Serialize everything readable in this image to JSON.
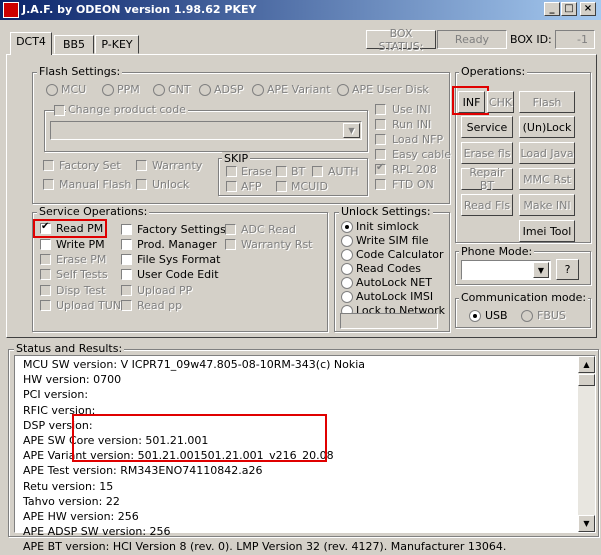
{
  "window": {
    "title": "J.A.F. by ODEON version 1.98.62 PKEY"
  },
  "tabs": [
    "DCT4",
    "BB5",
    "P-KEY"
  ],
  "header": {
    "box_status_label": "BOX STATUS:",
    "box_status_value": "Ready",
    "box_id_label": "BOX ID:",
    "box_id_value": "-1"
  },
  "flash_settings": {
    "title": "Flash Settings:",
    "radios": [
      "MCU",
      "PPM",
      "CNT",
      "ADSP",
      "APE Variant",
      "APE User Disk"
    ],
    "change_product_code": "Change product code",
    "options_right": [
      "Use INI",
      "Run INI",
      "Load NFP",
      "Easy cable",
      "RPL 208",
      "FTD ON"
    ],
    "factory_set": "Factory Set",
    "warranty": "Warranty",
    "manual_flash": "Manual Flash",
    "unlock": "Unlock",
    "skip_title": "SKIP",
    "skip_items": [
      "Erase",
      "BT",
      "AUTH",
      "AFP",
      "MCUID"
    ]
  },
  "service_operations": {
    "title": "Service Operations:",
    "col1": [
      "Read PM",
      "Write PM",
      "Erase PM",
      "Self Tests",
      "Disp Test",
      "Upload TUN"
    ],
    "col2": [
      "Factory Settings",
      "Prod. Manager",
      "File Sys Format",
      "User Code Edit",
      "Upload PP",
      "Read pp"
    ],
    "col3": [
      "ADC Read",
      "Warranty Rst"
    ]
  },
  "unlock_settings": {
    "title": "Unlock Settings:",
    "options": [
      "Init simlock",
      "Write SIM file",
      "Code Calculator",
      "Read Codes",
      "AutoLock NET",
      "AutoLock IMSI",
      "Lock to Network"
    ]
  },
  "operations": {
    "title": "Operations:",
    "buttons": [
      "INF",
      "CHK",
      "Flash",
      "Service",
      "(Un)Lock",
      "Erase fls",
      "Load Java",
      "Repair BT",
      "MMC Rst",
      "Read Fls",
      "Make INI",
      "Imei Tool"
    ]
  },
  "phone_mode": {
    "title": "Phone Mode:",
    "help": "?"
  },
  "comm_mode": {
    "title": "Communication mode:",
    "usb": "USB",
    "fbus": "FBUS"
  },
  "status": {
    "title": "Status and Results:",
    "lines": [
      "MCU SW version: V ICPR71_09w47.805-08-10RM-343(c) Nokia",
      "HW version: 0700",
      "PCI version:",
      "RFIC version:",
      "DSP version:",
      "APE SW Core version: 501.21.001",
      "APE Variant version: 501.21.001501.21.001_v216_20.08",
      "APE Test version: RM343ENO74110842.a26",
      "Retu version: 15",
      "Tahvo version: 22",
      "APE HW version: 256",
      "APE ADSP SW version: 256",
      "APE BT version: HCI Version 8 (rev. 0). LMP Version 32 (rev. 4127). Manufacturer 13064."
    ]
  }
}
